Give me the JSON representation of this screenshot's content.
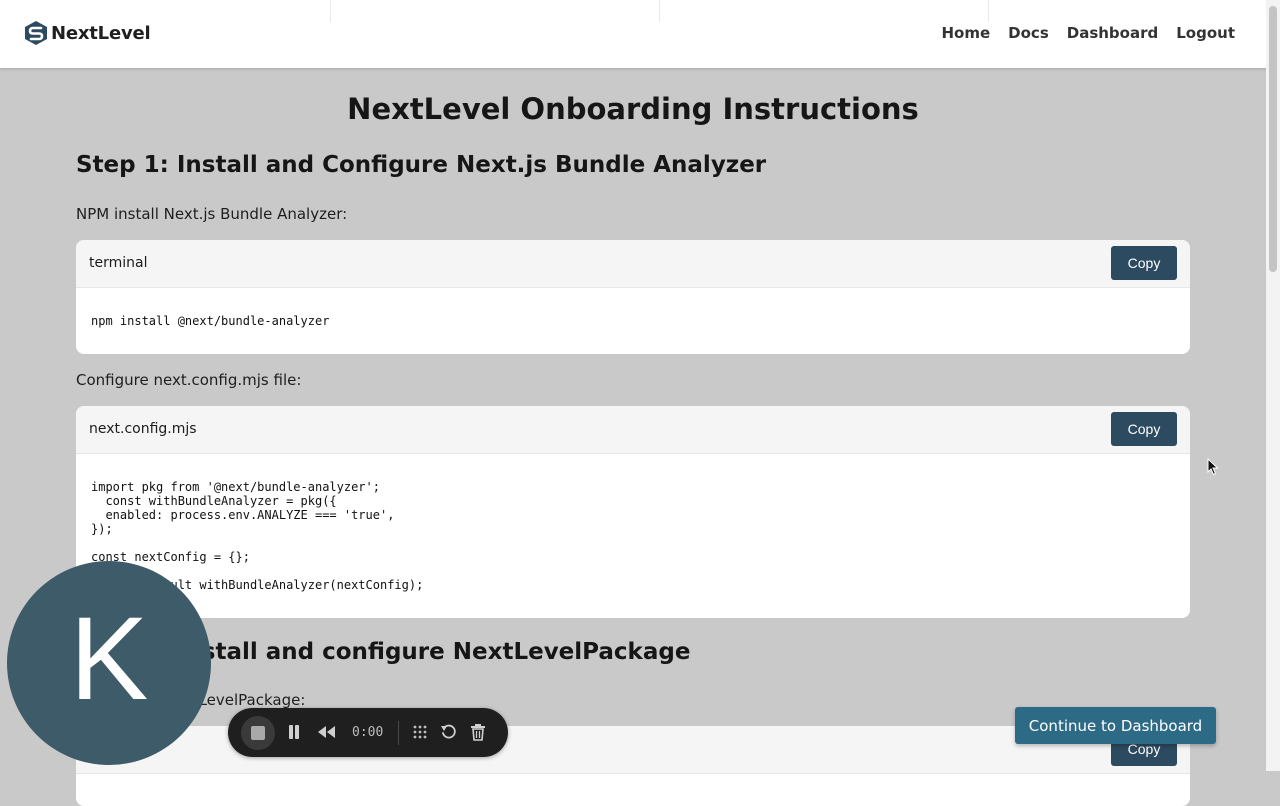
{
  "header": {
    "brand": "NextLevel",
    "nav": [
      "Home",
      "Docs",
      "Dashboard",
      "Logout"
    ]
  },
  "page": {
    "title": "NextLevel Onboarding Instructions",
    "step1": {
      "title": "Step 1: Install and Configure Next.js Bundle Analyzer",
      "npm_text": "NPM install Next.js Bundle Analyzer:",
      "terminal_block": {
        "filename": "terminal",
        "copy_label": "Copy",
        "code": "npm install @next/bundle-analyzer"
      },
      "configure_text": "Configure next.config.mjs file:",
      "config_block": {
        "filename": "next.config.mjs",
        "copy_label": "Copy",
        "code": "import pkg from '@next/bundle-analyzer';\n  const withBundleAnalyzer = pkg({\n  enabled: process.env.ANALYZE === 'true',\n});\n\nconst nextConfig = {};\n\nexport default withBundleAnalyzer(nextConfig);"
      }
    },
    "step2": {
      "title": "Step 2: Install and configure NextLevelPackage",
      "install_text": "NPM install NextLevelPackage:",
      "block": {
        "copy_label": "Copy"
      }
    }
  },
  "continue_button": "Continue to Dashboard",
  "avatar": {
    "initial": "K",
    "color": "#3e5b6a"
  },
  "recorder": {
    "time": "0:00"
  },
  "colors": {
    "accent": "#2c4a60",
    "continue": "#2c6a86",
    "background": "#c9c9c9"
  }
}
